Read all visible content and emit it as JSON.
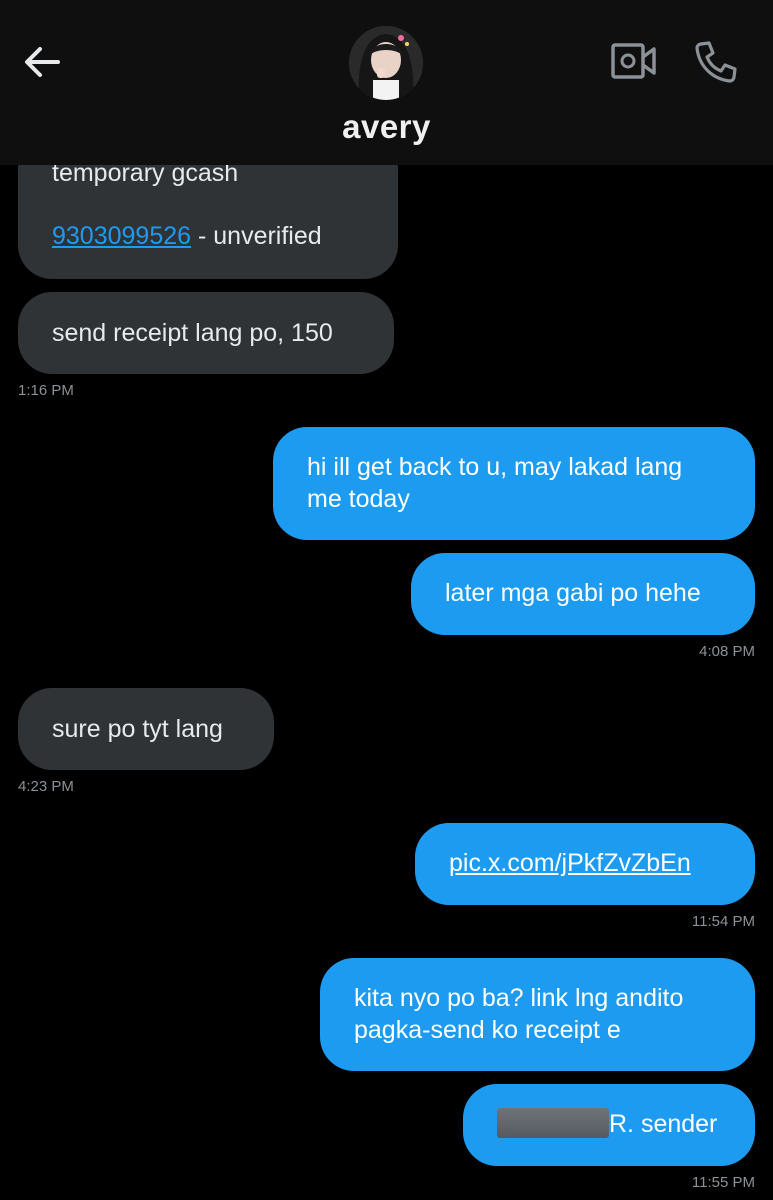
{
  "header": {
    "contact_name": "avery",
    "icons": {
      "back": "arrow-left-icon",
      "video": "video-call-icon",
      "call": "phone-icon"
    }
  },
  "messages": [
    {
      "dir": "in",
      "line1": "temporary gcash",
      "link": "9303099526",
      "line2_rest": " - unverified"
    },
    {
      "dir": "in",
      "text": "send receipt lang po, 150",
      "time": "1:16 PM"
    },
    {
      "dir": "out",
      "line1": "hi ill get back to u, may lakad lang",
      "line2": "me today"
    },
    {
      "dir": "out",
      "text": "later mga gabi po hehe",
      "time": "4:08 PM"
    },
    {
      "dir": "in",
      "text": "sure po tyt lang",
      "time": "4:23 PM"
    },
    {
      "dir": "out",
      "link": "pic.x.com/jPkfZvZbEn",
      "time": "11:54 PM"
    },
    {
      "dir": "out",
      "line1": "kita nyo po ba? link lng andito",
      "line2": "pagka-send ko receipt e"
    },
    {
      "dir": "out",
      "text": "R. sender",
      "time": "11:55 PM"
    }
  ],
  "colors": {
    "incoming": "#2f3336",
    "outgoing": "#1d9bf0",
    "link": "#1d9bf0",
    "background": "#000000"
  }
}
